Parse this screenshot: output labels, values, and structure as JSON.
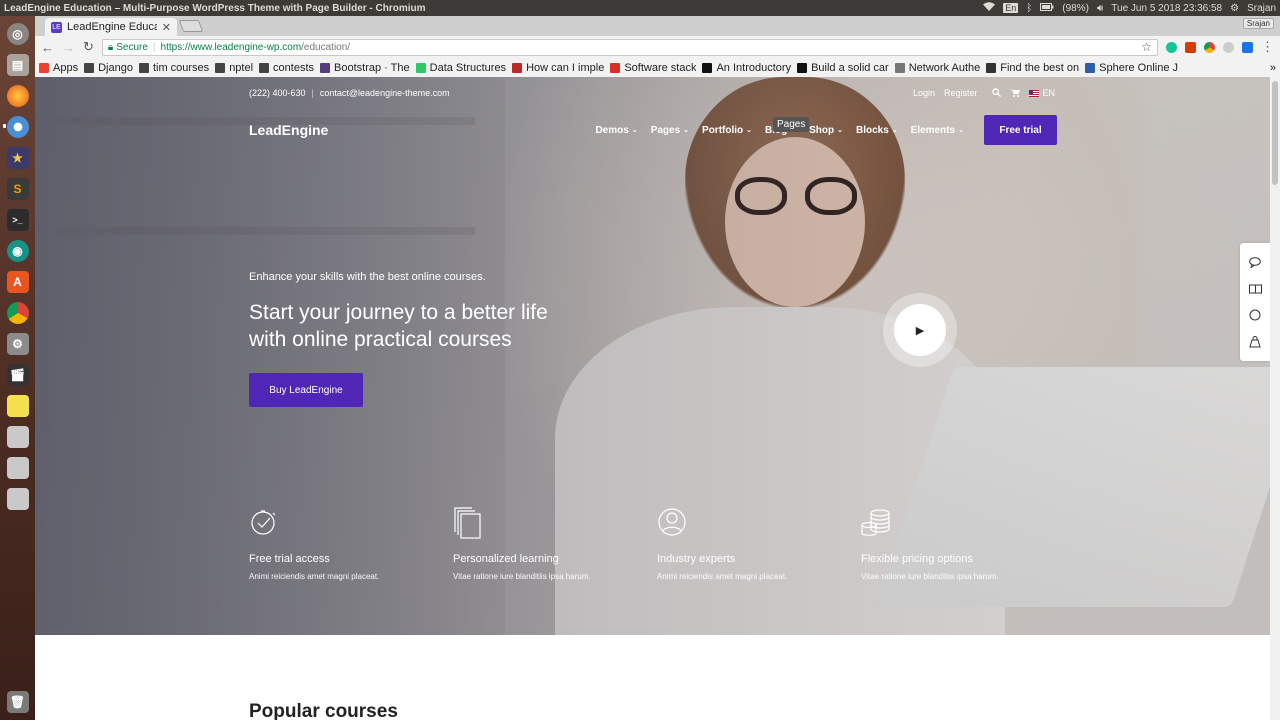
{
  "os": {
    "window_title": "LeadEngine Education – Multi-Purpose WordPress Theme with Page Builder - Chromium",
    "keyboard": "En",
    "battery": "(98%)",
    "datetime": "Tue Jun  5 2018 23:36:58",
    "user": "Srajan"
  },
  "launcher": {
    "apps": [
      "ubuntu-icon",
      "files-icon",
      "firefox-icon",
      "chromium-icon",
      "starred-icon",
      "sublime-icon",
      "terminal-icon",
      "gitkraken-icon",
      "software-center-icon",
      "chrome-icon",
      "settings-icon",
      "video-icon",
      "notes-icon",
      "drive-icon",
      "drive-icon",
      "drive-icon",
      "trash-icon"
    ]
  },
  "browser": {
    "tab_title": "LeadEngine Educati",
    "tab_favicon": "LE",
    "user_chip": "Srajan",
    "secure_label": "Secure",
    "url_scheme_host": "https://www.leadengine-wp.com",
    "url_path": "/education/",
    "bookmarks": [
      {
        "label": "Apps",
        "icon": "apps-grid-icon",
        "color": "#e94235"
      },
      {
        "label": "Django",
        "icon": "folder-icon",
        "color": "#444"
      },
      {
        "label": "tim courses",
        "icon": "folder-icon",
        "color": "#444"
      },
      {
        "label": "nptel",
        "icon": "folder-icon",
        "color": "#444"
      },
      {
        "label": "contests",
        "icon": "folder-icon",
        "color": "#444"
      },
      {
        "label": "Bootstrap · The",
        "icon": "bootstrap-icon",
        "color": "#563d7c"
      },
      {
        "label": "Data Structures",
        "icon": "hackerrank-icon",
        "color": "#2ec866"
      },
      {
        "label": "How can I imple",
        "icon": "quora-icon",
        "color": "#b92b27"
      },
      {
        "label": "Software stack",
        "icon": "chevron-icon",
        "color": "#d93025"
      },
      {
        "label": "An Introductory",
        "icon": "medium-icon",
        "color": "#111"
      },
      {
        "label": "Build a solid car",
        "icon": "medium-icon",
        "color": "#111"
      },
      {
        "label": "Network Authe",
        "icon": "doc-icon",
        "color": "#777"
      },
      {
        "label": "Find the best on",
        "icon": "devto-icon",
        "color": "#333"
      },
      {
        "label": "Sphere Online J",
        "icon": "spoj-icon",
        "color": "#2b5fa8"
      }
    ],
    "more": "»"
  },
  "site": {
    "phone": "(222) 400-630",
    "email": "contact@leadengine-theme.com",
    "login": "Login",
    "register": "Register",
    "lang": "EN",
    "logo": "LeadEngine",
    "menu": [
      "Demos",
      "Pages",
      "Portfolio",
      "Blog",
      "Shop",
      "Blocks",
      "Elements"
    ],
    "cta": "Free trial",
    "tooltip": "Pages",
    "tagline": "Enhance your skills with the best online courses.",
    "headline": "Start your journey to a better life with online practical courses",
    "buy_button": "Buy LeadEngine",
    "features": [
      {
        "icon": "stopwatch-icon",
        "title": "Free trial access",
        "desc": "Animi reiciendis amet magni placeat."
      },
      {
        "icon": "documents-icon",
        "title": "Personalized learning",
        "desc": "Vitae ratione iure blanditiis ipsa harum."
      },
      {
        "icon": "user-circle-icon",
        "title": "Industry experts",
        "desc": "Animi reiciendis amet magni placeat."
      },
      {
        "icon": "coins-icon",
        "title": "Flexible pricing options",
        "desc": "Vitae ratione iure blanditiis ipsa harum."
      }
    ],
    "popular": "Popular courses"
  },
  "colors": {
    "brand": "#4f26b5",
    "secure": "#0b8043"
  }
}
